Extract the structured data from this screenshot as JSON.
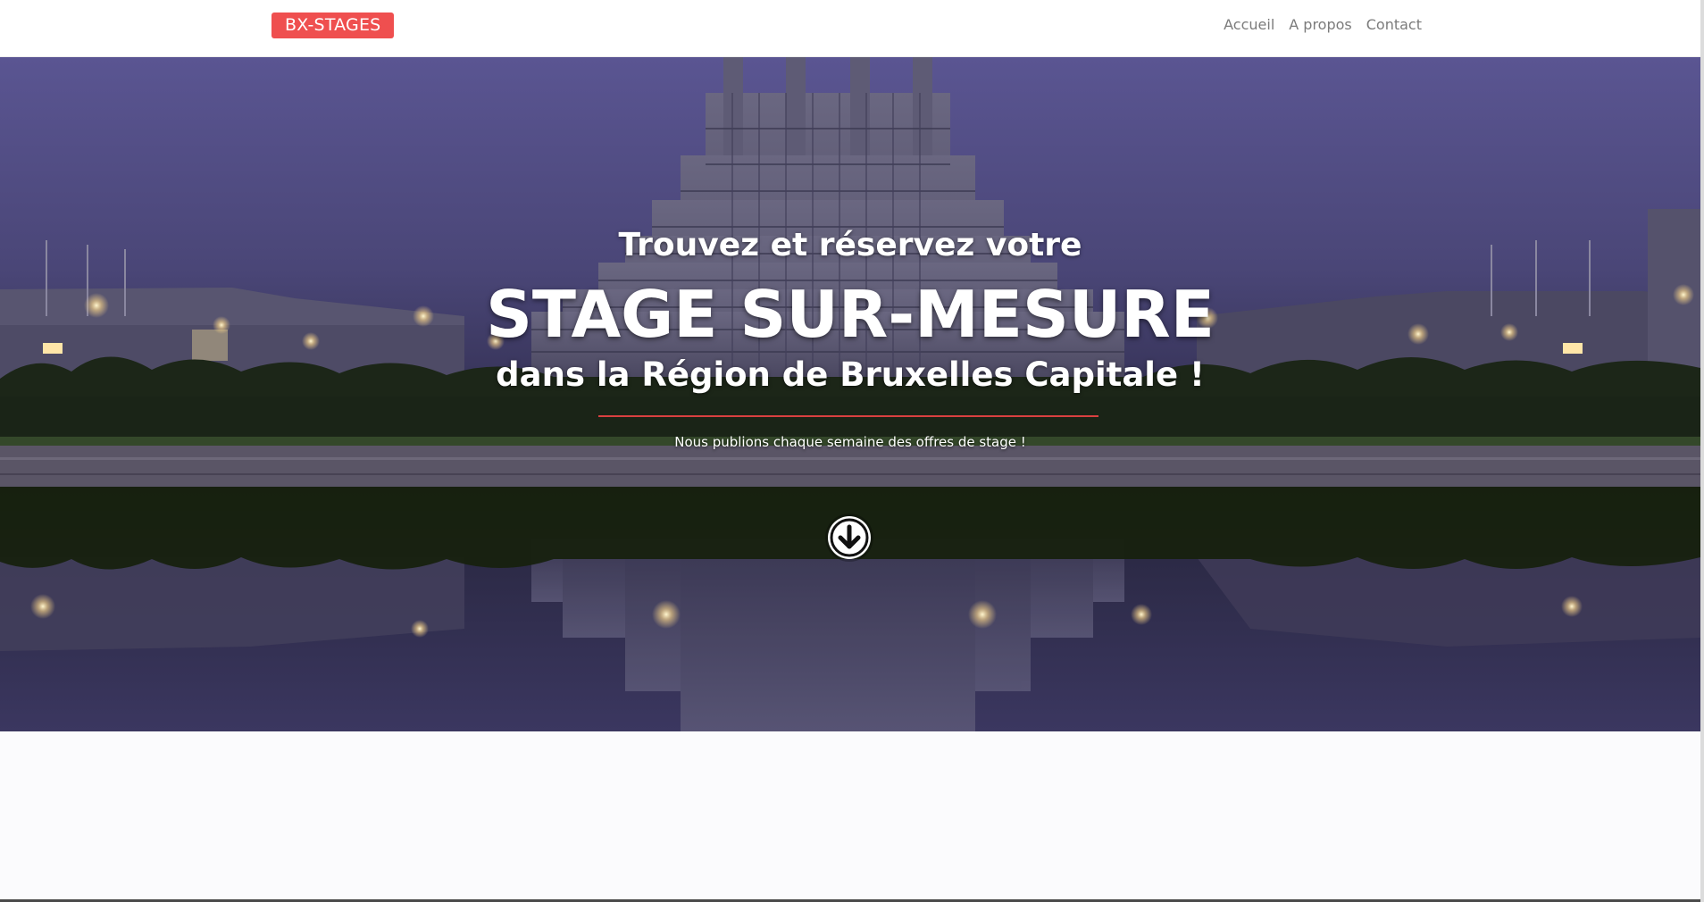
{
  "navbar": {
    "brand": "BX-STAGES",
    "links": [
      "Accueil",
      "A propos",
      "Contact"
    ]
  },
  "hero": {
    "subtitle_top": "Trouvez et réservez votre",
    "title": "STAGE SUR-MESURE",
    "subtitle_bottom": "dans la Région de Bruxelles Capitale !",
    "tagline": "Nous publions chaque semaine des offres de stage !",
    "scroll_icon": "arrow-down-circle-icon"
  },
  "colors": {
    "accent": "#ef4f4f",
    "divider": "#d94040",
    "nav_text": "#7b7b7b",
    "sky": "#5a5592"
  }
}
